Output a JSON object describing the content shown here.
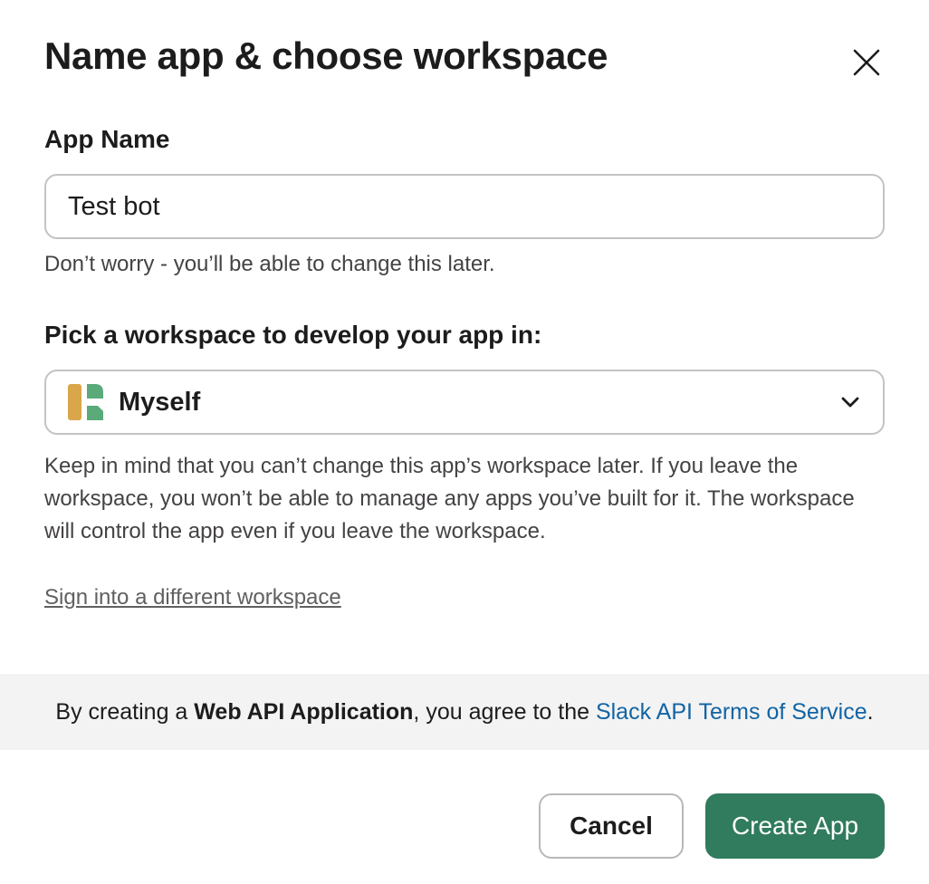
{
  "dialog": {
    "title": "Name app & choose workspace",
    "close_icon": "close-icon"
  },
  "app_name": {
    "label": "App Name",
    "value": "Test bot",
    "hint": "Don’t worry - you’ll be able to change this later."
  },
  "workspace": {
    "label": "Pick a workspace to develop your app in:",
    "selected": "Myself",
    "logo_icon": "workspace-logo-icon",
    "chevron_icon": "chevron-down-icon",
    "hint": "Keep in mind that you can’t change this app’s workspace later. If you leave the workspace, you won’t be able to manage any apps you’ve built for it. The workspace will control the app even if you leave the workspace.",
    "switch_link": "Sign into a different workspace"
  },
  "terms": {
    "prefix": "By creating a ",
    "bold": "Web API Application",
    "middle": ", you agree to the ",
    "link": "Slack API Terms of Service",
    "suffix": "."
  },
  "buttons": {
    "cancel": "Cancel",
    "create": "Create App"
  },
  "colors": {
    "primary_button": "#317b5e",
    "link": "#1264a3",
    "logo_yellow": "#d9a64a",
    "logo_green": "#5aaa7a"
  }
}
